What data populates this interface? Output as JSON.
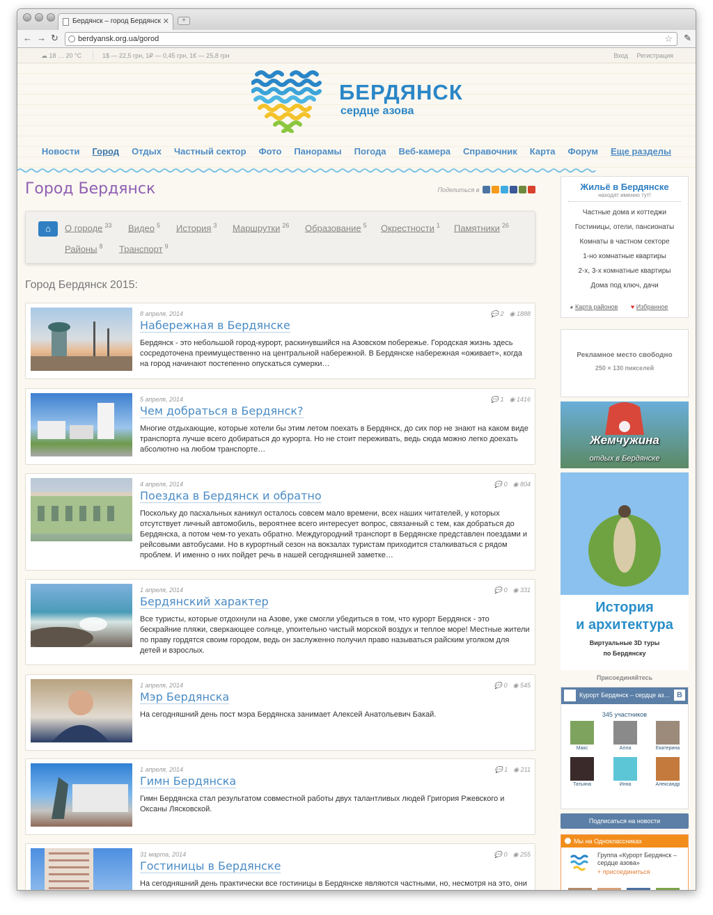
{
  "browser": {
    "tab_title": "Бердянск – город Бердянск",
    "new_tab_icon": "+",
    "url": "berdyansk.org.ua/gorod"
  },
  "infobar": {
    "weather": "18 … 20 °C",
    "rates": "1$ — 22,5 грн, 1₽ — 0,45 грн, 1€ — 25,8 грн",
    "login": "Вход",
    "register": "Регистрация"
  },
  "logo": {
    "title": "БЕРДЯНСК",
    "subtitle": "сердце азова"
  },
  "nav": {
    "items": [
      "Новости",
      "Город",
      "Отдых",
      "Частный сектор",
      "Фото",
      "Панорамы",
      "Погода",
      "Веб-камера",
      "Справочник",
      "Карта",
      "Форум",
      "Еще разделы"
    ]
  },
  "page": {
    "title": "Город Бердянск",
    "share_label": "Поделиться в",
    "section_heading": "Город Бердянск 2015:"
  },
  "subnav": {
    "items": [
      {
        "label": "О городе",
        "count": "33"
      },
      {
        "label": "Видео",
        "count": "5"
      },
      {
        "label": "История",
        "count": "3"
      },
      {
        "label": "Маршрутки",
        "count": "26"
      },
      {
        "label": "Образование",
        "count": "5"
      },
      {
        "label": "Окрестности",
        "count": "1"
      },
      {
        "label": "Памятники",
        "count": "26"
      },
      {
        "label": "Районы",
        "count": "8"
      },
      {
        "label": "Транспорт",
        "count": "9"
      }
    ]
  },
  "articles": [
    {
      "date": "8 апреля, 2014",
      "comments": "2",
      "views": "1888",
      "title": "Набережная в Бердянске",
      "text": "Бердянск - это небольшой город-курорт, раскинувшийся на Азовском побережье. Городская жизнь здесь сосредоточена преимущественно на центральной набережной. В Бердянске набережная «оживает», когда на город начинают постепенно опускаться сумерки…"
    },
    {
      "date": "5 апреля, 2014",
      "comments": "1",
      "views": "1416",
      "title": "Чем добраться в Бердянск?",
      "text": "Многие отдыхающие, которые хотели бы этим летом поехать в Бердянск, до сих пор не знают на каком виде транспорта лучше всего добираться до курорта. Но не стоит переживать, ведь сюда можно легко доехать абсолютно на любом транспорте…"
    },
    {
      "date": "4 апреля, 2014",
      "comments": "0",
      "views": "804",
      "title": "Поездка в Бердянск и обратно",
      "text": "Поскольку до пасхальных каникул осталось совсем мало времени, всех наших читателей, у которых отсутствует личный автомобиль, вероятнее всего интересует вопрос, связанный с тем, как добраться до Бердянска, а потом чем-то уехать обратно. Междугородний транспорт в Бердянске представлен поездами и рейсовыми автобусами. Но в курортный сезон на вокзалах туристам приходится сталкиваться с рядом проблем. И именно о них пойдет речь в нашей сегодняшней заметке…"
    },
    {
      "date": "1 апреля, 2014",
      "comments": "0",
      "views": "331",
      "title": "Бердянский характер",
      "text": "Все туристы, которые отдохнули на Азове, уже смогли убедиться в том, что курорт Бердянск - это бескрайние пляжи, сверкающее солнце, упоительно чистый морской воздух и теплое море! Местные жители по праву гордятся своим городом, ведь он заслуженно получил право называться райским уголком для детей и взрослых."
    },
    {
      "date": "1 апреля, 2014",
      "comments": "0",
      "views": "545",
      "title": "Мэр Бердянска",
      "text": "На сегодняшний день пост мэра Бердянска занимает Алексей Анатольевич Бакай."
    },
    {
      "date": "1 апреля, 2014",
      "comments": "1",
      "views": "211",
      "title": "Гимн Бердянска",
      "text": "Гимн Бердянска стал результатом совместной работы двух талантливых людей Григория Ржевского и Оксаны Лясковской."
    },
    {
      "date": "31 марта, 2014",
      "comments": "0",
      "views": "255",
      "title": "Гостиницы в Бердянске",
      "text": "На сегодняшний день практически все гостиницы в Бердянске являются частными, но, несмотря на это, они"
    }
  ],
  "housing": {
    "title": "Жильё в Бердянске",
    "subtitle": "находят именно тут!",
    "items": [
      "Частные дома и коттеджи",
      "Гостиницы, отели, пансионаты",
      "Комнаты в частном секторе",
      "1-но комнатные квартиры",
      "2-х, 3-х комнатные квартиры",
      "Дома под ключ, дачи"
    ],
    "map_link": "Карта районов",
    "fav_link": "Избранное"
  },
  "ad": {
    "line1": "Рекламное место свободно",
    "line2": "250 × 130 пикселей"
  },
  "promo1": {
    "brand": "Жемчужина",
    "caption": "отдых в Бердянске"
  },
  "promo2": {
    "title1": "История",
    "title2": "и архитектура",
    "sub1": "Виртуальные 3D туры",
    "sub2": "по Бердянску"
  },
  "vk": {
    "join_label": "Присоединяйтесь",
    "group": "Курорт Бердянск – сердце аз…",
    "badge": "В",
    "members_count": "345 участников",
    "members": [
      "Макс",
      "Алла",
      "Екатерина",
      "Татьяна",
      "Инна",
      "Александр"
    ],
    "subscribe": "Подписаться на новости"
  },
  "ok": {
    "header": "Мы на Одноклассниках",
    "group": "Группа «Курорт Бердянск – сердце азова»",
    "join": "присоединиться"
  },
  "colors": {
    "brand_blue": "#2a86c7",
    "nav_blue": "#4d8cc5",
    "title_purple": "#8f5fb3",
    "vk_blue": "#5b7fa6",
    "ok_orange": "#f28d1b"
  }
}
